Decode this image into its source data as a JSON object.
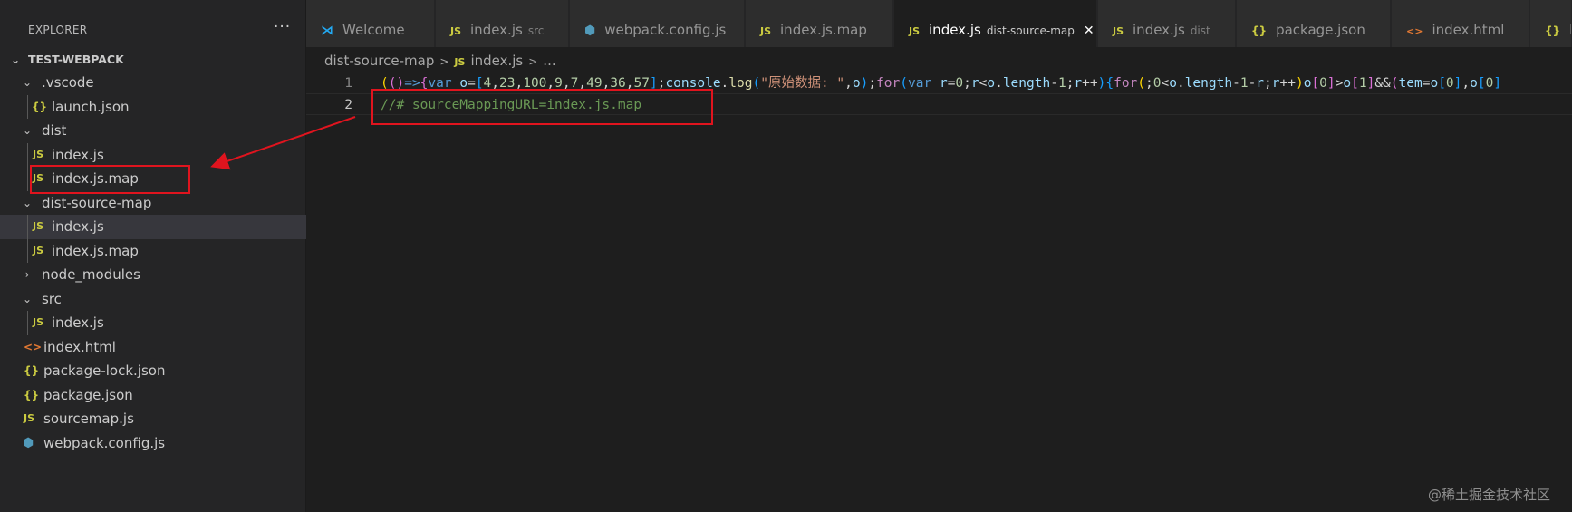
{
  "sidebar": {
    "title": "EXPLORER",
    "more": "···",
    "root": "TEST-WEBPACK",
    "items": [
      {
        "label": ".vscode",
        "type": "folder"
      },
      {
        "label": "launch.json",
        "type": "json"
      },
      {
        "label": "dist",
        "type": "folder"
      },
      {
        "label": "index.js",
        "type": "js"
      },
      {
        "label": "index.js.map",
        "type": "js"
      },
      {
        "label": "dist-source-map",
        "type": "folder"
      },
      {
        "label": "index.js",
        "type": "js"
      },
      {
        "label": "index.js.map",
        "type": "js"
      },
      {
        "label": "node_modules",
        "type": "folder-collapsed"
      },
      {
        "label": "src",
        "type": "folder"
      },
      {
        "label": "index.js",
        "type": "js"
      },
      {
        "label": "index.html",
        "type": "html"
      },
      {
        "label": "package-lock.json",
        "type": "json"
      },
      {
        "label": "package.json",
        "type": "json"
      },
      {
        "label": "sourcemap.js",
        "type": "js"
      },
      {
        "label": "webpack.config.js",
        "type": "webpack"
      }
    ]
  },
  "icons": {
    "js": "JS",
    "json": "{}",
    "html": "<>",
    "webpack": "⬢",
    "vscode": "⋊"
  },
  "tabs": [
    {
      "label": "Welcome",
      "desc": "",
      "icon": "vscode"
    },
    {
      "label": "index.js",
      "desc": "src",
      "icon": "js"
    },
    {
      "label": "webpack.config.js",
      "desc": "",
      "icon": "webpack"
    },
    {
      "label": "index.js.map",
      "desc": "",
      "icon": "js"
    },
    {
      "label": "index.js",
      "desc": "dist-source-map",
      "icon": "js",
      "active": true,
      "close": "✕"
    },
    {
      "label": "index.js",
      "desc": "dist",
      "icon": "js"
    },
    {
      "label": "package.json",
      "desc": "",
      "icon": "json"
    },
    {
      "label": "index.html",
      "desc": "",
      "icon": "html"
    },
    {
      "label": "lau",
      "desc": "",
      "icon": "json"
    }
  ],
  "breadcrumb": {
    "folder": "dist-source-map",
    "sep": ">",
    "file": "index.js",
    "more": "..."
  },
  "editor": {
    "line_numbers": [
      "1",
      "2"
    ],
    "line1_tokens": [
      [
        "br1",
        "("
      ],
      [
        "br2",
        "("
      ],
      [
        "br2",
        ")"
      ],
      [
        "kw",
        "=>"
      ],
      [
        "br2",
        "{"
      ],
      [
        "kw",
        "var"
      ],
      [
        "punc",
        " "
      ],
      [
        "var",
        "o"
      ],
      [
        "punc",
        "="
      ],
      [
        "br3",
        "["
      ],
      [
        "num",
        "4"
      ],
      [
        "punc",
        ","
      ],
      [
        "num",
        "23"
      ],
      [
        "punc",
        ","
      ],
      [
        "num",
        "100"
      ],
      [
        "punc",
        ","
      ],
      [
        "num",
        "9"
      ],
      [
        "punc",
        ","
      ],
      [
        "num",
        "7"
      ],
      [
        "punc",
        ","
      ],
      [
        "num",
        "49"
      ],
      [
        "punc",
        ","
      ],
      [
        "num",
        "36"
      ],
      [
        "punc",
        ","
      ],
      [
        "num",
        "57"
      ],
      [
        "br3",
        "]"
      ],
      [
        "punc",
        ";"
      ],
      [
        "var",
        "console"
      ],
      [
        "punc",
        "."
      ],
      [
        "fn",
        "log"
      ],
      [
        "br3",
        "("
      ],
      [
        "str",
        "\"原始数据: \""
      ],
      [
        "punc",
        ","
      ],
      [
        "var",
        "o"
      ],
      [
        "br3",
        ")"
      ],
      [
        "punc",
        ";"
      ],
      [
        "kw2",
        "for"
      ],
      [
        "br3",
        "("
      ],
      [
        "kw",
        "var"
      ],
      [
        "punc",
        " "
      ],
      [
        "var",
        "r"
      ],
      [
        "punc",
        "="
      ],
      [
        "num",
        "0"
      ],
      [
        "punc",
        ";"
      ],
      [
        "var",
        "r"
      ],
      [
        "punc",
        "<"
      ],
      [
        "var",
        "o"
      ],
      [
        "punc",
        "."
      ],
      [
        "var",
        "length"
      ],
      [
        "punc",
        "-"
      ],
      [
        "num",
        "1"
      ],
      [
        "punc",
        ";"
      ],
      [
        "var",
        "r"
      ],
      [
        "punc",
        "++"
      ],
      [
        "br3",
        ")"
      ],
      [
        "br3",
        "{"
      ],
      [
        "kw2",
        "for"
      ],
      [
        "br1",
        "("
      ],
      [
        "punc",
        ";"
      ],
      [
        "num",
        "0"
      ],
      [
        "punc",
        "<"
      ],
      [
        "var",
        "o"
      ],
      [
        "punc",
        "."
      ],
      [
        "var",
        "length"
      ],
      [
        "punc",
        "-"
      ],
      [
        "num",
        "1"
      ],
      [
        "punc",
        "-"
      ],
      [
        "var",
        "r"
      ],
      [
        "punc",
        ";"
      ],
      [
        "var",
        "r"
      ],
      [
        "punc",
        "++"
      ],
      [
        "br1",
        ")"
      ],
      [
        "var",
        "o"
      ],
      [
        "br2",
        "["
      ],
      [
        "num",
        "0"
      ],
      [
        "br2",
        "]"
      ],
      [
        "punc",
        ">"
      ],
      [
        "var",
        "o"
      ],
      [
        "br2",
        "["
      ],
      [
        "num",
        "1"
      ],
      [
        "br2",
        "]"
      ],
      [
        "punc",
        "&&"
      ],
      [
        "br2",
        "("
      ],
      [
        "var",
        "tem"
      ],
      [
        "punc",
        "="
      ],
      [
        "var",
        "o"
      ],
      [
        "br3",
        "["
      ],
      [
        "num",
        "0"
      ],
      [
        "br3",
        "]"
      ],
      [
        "punc",
        ","
      ],
      [
        "var",
        "o"
      ],
      [
        "br3",
        "["
      ],
      [
        "num",
        "0"
      ],
      [
        "br3",
        "]"
      ]
    ],
    "line2_comment": "//# sourceMappingURL=index.js.map"
  },
  "watermark": "@稀土掘金技术社区"
}
